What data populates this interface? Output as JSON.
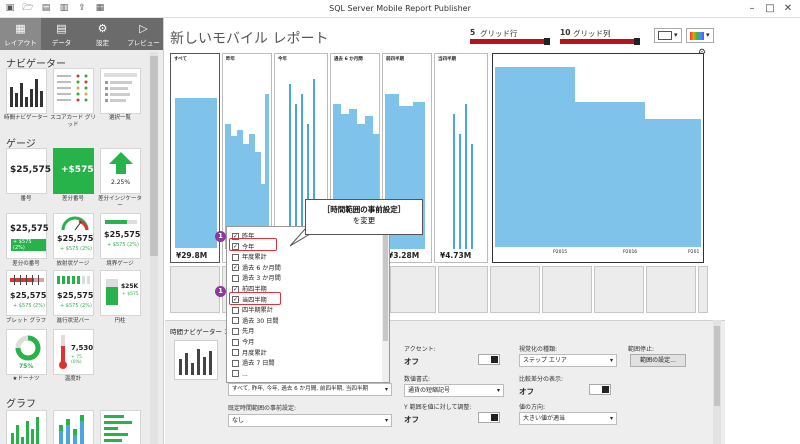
{
  "app": {
    "title": "SQL Server Mobile Report Publisher"
  },
  "tabs": [
    {
      "label": "レイアウト",
      "icon": "layout-icon"
    },
    {
      "label": "データ",
      "icon": "data-icon"
    },
    {
      "label": "設定",
      "icon": "settings-icon"
    },
    {
      "label": "プレビュー",
      "icon": "preview-icon"
    }
  ],
  "sidebar": {
    "navigators_header": "ナビゲーター",
    "navigators": [
      {
        "label": "時間ナビゲーター"
      },
      {
        "label": "スコアカード グリッド"
      },
      {
        "label": "選択一覧"
      }
    ],
    "gauges_header": "ゲージ",
    "gauges": [
      {
        "label": "番号",
        "value": "$25,575"
      },
      {
        "label": "差分番号",
        "value": "+$575"
      },
      {
        "label": "差分インジケーター",
        "value": "2.25%"
      },
      {
        "label": "差分の番号",
        "value": "$25,575",
        "delta": "+ $575 (2%)"
      },
      {
        "label": "放射状ゲージ",
        "value": "$25,575",
        "delta": "+ $575 (2%)"
      },
      {
        "label": "境界ゲージ",
        "value": "$25,575",
        "delta": "+ $575 (2%)"
      },
      {
        "label": "ブレット グラフ",
        "value": "$25,575",
        "delta": "+ $575 (2%)"
      },
      {
        "label": "進行状況バー",
        "value": "$25,575",
        "delta": "+ $575 (2%)"
      },
      {
        "label": "円柱",
        "value": "$25K",
        "delta": "+ $575"
      },
      {
        "label": "★ドーナツ",
        "value": "75%"
      },
      {
        "label": "温度計",
        "value": "7,530",
        "delta": "+ 75 (0%)"
      }
    ],
    "charts_header": "グラフ"
  },
  "report": {
    "title": "新しいモバイル レポート",
    "grid_rows_value": "5",
    "grid_rows_label": "グリッド行",
    "grid_cols_value": "10",
    "grid_cols_label": "グリッド列"
  },
  "panels": [
    {
      "label": "すべて",
      "value": "¥29.8M"
    },
    {
      "label": "昨年",
      "value": ""
    },
    {
      "label": "今年",
      "value": ""
    },
    {
      "label": "過去 6 か月間",
      "value": ""
    },
    {
      "label": "前四半期",
      "value": "¥3.28M"
    },
    {
      "label": "当四半期",
      "value": "¥4.73M"
    }
  ],
  "big_chart": {
    "ticks": [
      "P2015",
      "P2016",
      "P201"
    ]
  },
  "dropdown": {
    "items": [
      {
        "label": "昨年",
        "checked": true
      },
      {
        "label": "今年",
        "checked": true
      },
      {
        "label": "年度累計",
        "checked": false
      },
      {
        "label": "過去 6 か月間",
        "checked": true
      },
      {
        "label": "過去 3 か月間",
        "checked": false
      },
      {
        "label": "前四半期",
        "checked": true
      },
      {
        "label": "当四半期",
        "checked": true
      },
      {
        "label": "四半期累計",
        "checked": false
      },
      {
        "label": "過去 30 日間",
        "checked": false
      },
      {
        "label": "先月",
        "checked": false
      },
      {
        "label": "今月",
        "checked": false
      },
      {
        "label": "月度累計",
        "checked": false
      },
      {
        "label": "過去 7 日間",
        "checked": false
      },
      {
        "label": "...",
        "checked": false
      }
    ],
    "summary": "すべて, 昨年, 今年, 過去 6 か月間, 前四半期, 当四半期"
  },
  "callout": {
    "line1": "［時間範囲の事前設定］",
    "line2": "を変更"
  },
  "markers": [
    "1",
    "1"
  ],
  "properties": {
    "selected_name": "時間ナビゲーター 1",
    "animation_label": "アクセント:",
    "animation_value": "オフ",
    "number_format_label": "数値書式:",
    "number_format_value": "通貨の短縮記号",
    "y_axis_label": "Y 範囲を値に対して調整:",
    "y_axis_value": "オフ",
    "preset_label": "既定時間範囲の事前設定:",
    "preset_value": "なし",
    "viz_type_label": "視覚化の種類:",
    "viz_type_value": "ステップ エリア",
    "compare_label": "比較差分の表示:",
    "compare_value": "オフ",
    "direction_label": "値の方向:",
    "direction_value": "大きい値が適当",
    "range_stop_label": "範囲停止:",
    "range_button": "範囲の設定..."
  }
}
